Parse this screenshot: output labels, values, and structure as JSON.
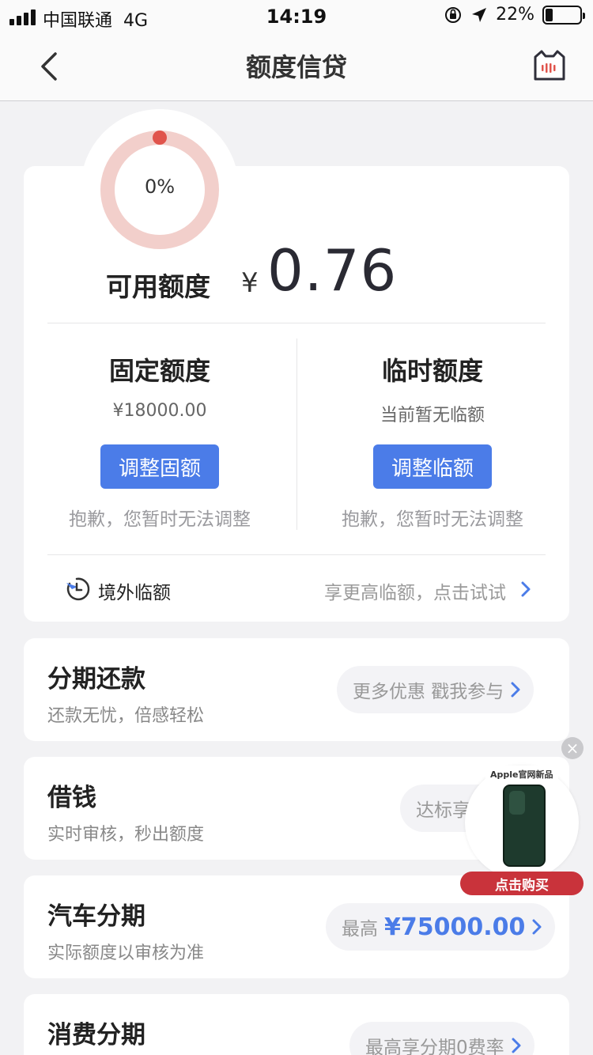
{
  "status_bar": {
    "carrier": "中国联通",
    "network": "4G",
    "time": "14:19",
    "battery": "22%"
  },
  "nav": {
    "title": "额度信贷",
    "back_icon": "chevron-left-icon",
    "service_icon": "cat-service-icon"
  },
  "credit": {
    "ring_percent": "0%",
    "ring_progress": 0,
    "available_label": "可用额度",
    "currency": "¥",
    "available_amount": "0.76"
  },
  "fixed": {
    "title": "固定额度",
    "value": "¥18000.00",
    "button": "调整固额",
    "note": "抱歉，您暂时无法调整"
  },
  "temporary": {
    "title": "临时额度",
    "value": "当前暂无临额",
    "button": "调整临额",
    "note": "抱歉，您暂时无法调整"
  },
  "overseas": {
    "label": "境外临额",
    "hint": "享更高临额，点击试试"
  },
  "services": [
    {
      "title": "分期还款",
      "subtitle": "还款无忧，倍感轻松",
      "pill_text": "更多优惠 戳我参与"
    },
    {
      "title": "借钱",
      "subtitle": "实时审核，秒出额度",
      "pill_text": "达标享"
    },
    {
      "title": "汽车分期",
      "subtitle": "实际额度以审核为准",
      "pill_prefix": "最高",
      "pill_amount": "¥75000.00"
    },
    {
      "title": "消费分期",
      "subtitle": "",
      "pill_text": "最高享分期0费率"
    }
  ],
  "ad": {
    "tag": "Apple官网新品",
    "button": "点击购买",
    "close": "×"
  },
  "colors": {
    "accent": "#4b7ce8",
    "ring": "#f2cfcb",
    "ring_dot": "#e0544c",
    "ad_red": "#c9333b"
  }
}
